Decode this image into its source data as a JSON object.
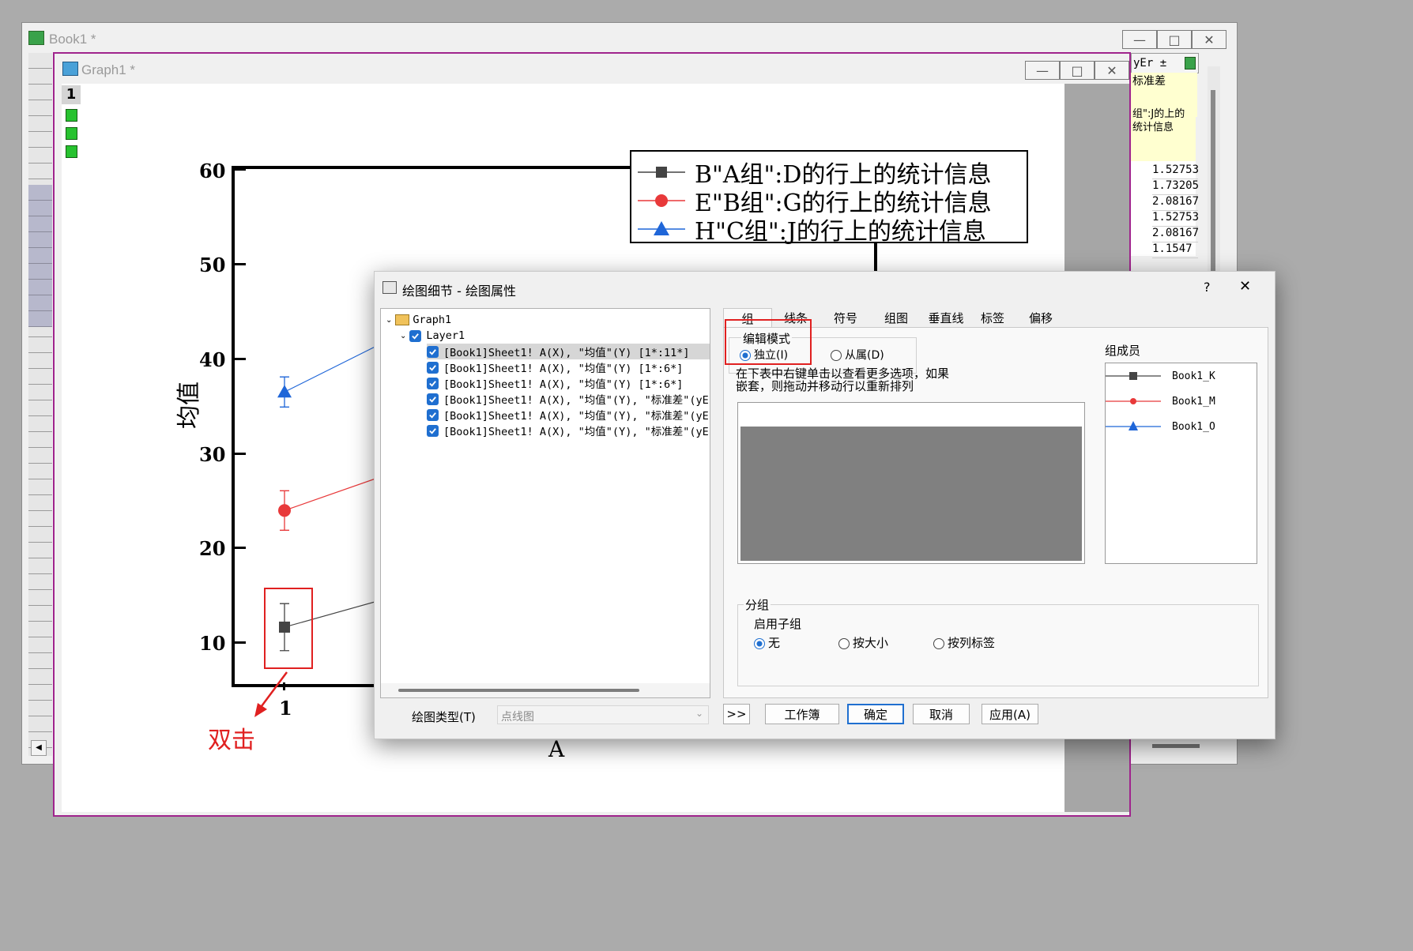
{
  "book1": {
    "title": "Book1 *",
    "col_header": "yEr ±",
    "long_name": "标准差",
    "comment": "组\":J的上的统计信息",
    "values": [
      "1.52753",
      "1.73205",
      "2.08167",
      "1.52753",
      "2.08167",
      "1.1547"
    ]
  },
  "graph1": {
    "title": "Graph1 *",
    "layer_num": "1"
  },
  "chart_data": {
    "type": "line",
    "ylabel": "均值",
    "xlabel": "A",
    "x_tick_visible": "1",
    "ylim": [
      5,
      60
    ],
    "yticks": [
      "10",
      "20",
      "30",
      "40",
      "50",
      "60"
    ],
    "legend_placement": "top-right",
    "series": [
      {
        "name": "B\"A组\":D的行上的统计信息",
        "color": "#444444",
        "marker": "square",
        "x": [
          1
        ],
        "y": [
          11.3
        ],
        "err": [
          2.5
        ]
      },
      {
        "name": "E\"B组\":G的行上的统计信息",
        "color": "#e8393a",
        "marker": "circle",
        "x": [
          1
        ],
        "y": [
          23.7
        ],
        "err": [
          2.1
        ]
      },
      {
        "name": "H\"C组\":J的行上的统计信息",
        "color": "#1f66d8",
        "marker": "triangle",
        "x": [
          1
        ],
        "y": [
          36.3
        ],
        "err": [
          1.6
        ]
      }
    ],
    "annotation": "双击"
  },
  "dialog": {
    "title": "绘图细节 - 绘图属性",
    "help": "?",
    "close": "✕",
    "tree": {
      "root": "Graph1",
      "layer": "Layer1",
      "items": [
        "[Book1]Sheet1! A(X), \"均值\"(Y) [1*:11*]",
        "[Book1]Sheet1! A(X), \"均值\"(Y) [1*:6*]",
        "[Book1]Sheet1! A(X), \"均值\"(Y) [1*:6*]",
        "[Book1]Sheet1! A(X), \"均值\"(Y), \"标准差\"(yE",
        "[Book1]Sheet1! A(X), \"均值\"(Y), \"标准差\"(yE",
        "[Book1]Sheet1! A(X), \"均值\"(Y), \"标准差\"(yE"
      ]
    },
    "tabs": [
      "组",
      "线条",
      "符号",
      "组图",
      "垂直线",
      "标签",
      "偏移"
    ],
    "edit_mode_label": "编辑模式",
    "edit_mode_options": [
      "独立(I)",
      "从属(D)"
    ],
    "hint": [
      "在下表中右键单击以查看更多选项，如果",
      "嵌套，则拖动并移动行以重新排列"
    ],
    "members_label": "组成员",
    "members": [
      "Book1_K",
      "Book1_M",
      "Book1_O"
    ],
    "subgroup_label": "分组",
    "enable_sub_label": "启用子组",
    "enable_sub_options": [
      "无",
      "按大小",
      "按列标签"
    ],
    "plot_type_label": "绘图类型(T)",
    "plot_type_value": "点线图",
    "buttons": {
      "more": ">>",
      "workbook": "工作簿",
      "ok": "确定",
      "cancel": "取消",
      "apply": "应用(A)"
    }
  },
  "colors": {
    "accent": "#1f6fd0",
    "graph_border": "#a0248d",
    "highlight_red": "#e02020"
  }
}
